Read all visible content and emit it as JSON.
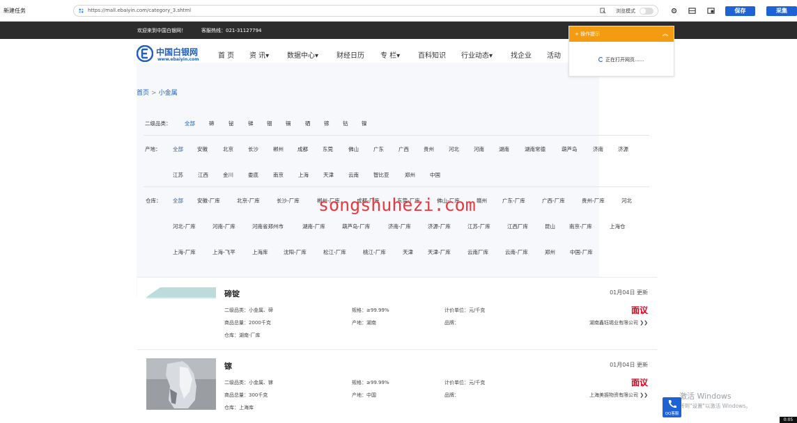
{
  "toolbar": {
    "title": "新建任务",
    "url": "https://mall.ebaiyin.com/category_3.shtml",
    "browse_mode_label": "浏览模式",
    "save_label": "保存",
    "collect_label": "采集"
  },
  "topbar": {
    "welcome": "欢迎来到中国白银网！",
    "hotline": "客服热线：021-31127794"
  },
  "site": {
    "logo_name": "中国白银网",
    "logo_url": "www.ebaiyin.com",
    "nav": [
      "首 页",
      "资 讯▾",
      "数据中心▾",
      "财经日历",
      "专 栏▾",
      "百科知识",
      "行业动态▾",
      "找企业",
      "活动"
    ]
  },
  "breadcrumb": {
    "home": "首页",
    "sep": ">",
    "current": "小金属"
  },
  "filters": {
    "level2": {
      "label": "二级品类：",
      "options": [
        "全部",
        "碲",
        "铋",
        "锑",
        "铟",
        "镉",
        "硒",
        "镓",
        "钴",
        "镍"
      ]
    },
    "origin": {
      "label": "产地：",
      "row1": [
        "全部",
        "安徽",
        "北京",
        "长沙",
        "郴州",
        "成都",
        "东莞",
        "佛山",
        "广东",
        "广西",
        "贵州",
        "河北",
        "河南",
        "湖南",
        "湖南常德",
        "葫芦岛",
        "济南",
        "济源"
      ],
      "row2": [
        "江苏",
        "江西",
        "金川",
        "娄底",
        "南京",
        "上海",
        "天津",
        "云南",
        "智比亚",
        "郑州",
        "中国"
      ]
    },
    "warehouse": {
      "label": "仓库：",
      "row1": [
        "全部",
        "安徽-厂库",
        "北京-厂库",
        "长沙-厂库",
        "郴州-厂库",
        "成都-厂库",
        "东莞-厂库",
        "佛山-厂库",
        "赣州",
        "广东-厂库",
        "广西-厂库",
        "贵州-厂库",
        "河北"
      ],
      "row2": [
        "河北-厂库",
        "河南-厂库",
        "河南省郑州市",
        "湖南-厂库",
        "葫芦岛-厂库",
        "济南-厂库",
        "济源-厂库",
        "江苏-厂库",
        "江西厂库",
        "昆山",
        "南京-厂库",
        "上海仓"
      ],
      "row3": [
        "上海-厂库",
        "上海-飞平",
        "上海库",
        "沈阳-厂库",
        "松江-厂库",
        "桃江-厂库",
        "天津",
        "天津-厂库",
        "云南厂库",
        "云南-厂库",
        "郑州",
        "中国-厂库"
      ]
    }
  },
  "watermark": "songshuhezi.com",
  "products": [
    {
      "title": "碲锭",
      "date": "01月04日 更新",
      "price": "面议",
      "company": "湖南鑫钰锡业有限公司",
      "category_label": "二级品类：",
      "category": "小金属、碲",
      "spec_label": "规格：",
      "spec": "≥99.99%",
      "unit_label": "计价单位：",
      "unit": "元/千克",
      "qty_label": "商品总量：",
      "qty": "2000千克",
      "origin_label": "产地：",
      "origin": "湖南",
      "brand_label": "品牌：",
      "brand": "",
      "warehouse_label": "仓库：",
      "warehouse": "湖南-厂库"
    },
    {
      "title": "镓",
      "date": "01月04日 更新",
      "price": "面议",
      "company": "上海美振物资有限公司",
      "category_label": "二级品类：",
      "category": "小金属、镓",
      "spec_label": "规格：",
      "spec": "≥99.99%",
      "unit_label": "计价单位：",
      "unit": "元/千克",
      "qty_label": "商品总量：",
      "qty": "300千克",
      "origin_label": "产地：",
      "origin": "中国",
      "brand_label": "品牌：",
      "brand": "",
      "warehouse_label": "仓库：",
      "warehouse": "上海库"
    }
  ],
  "popup": {
    "title": "操作提示",
    "message": "正在打开网页......"
  },
  "windows": {
    "activate": "激活 Windows",
    "hint": "转到\"设置\"以激活 Windows。"
  },
  "qq": {
    "label": "QQ客服"
  },
  "clock": "0:05"
}
